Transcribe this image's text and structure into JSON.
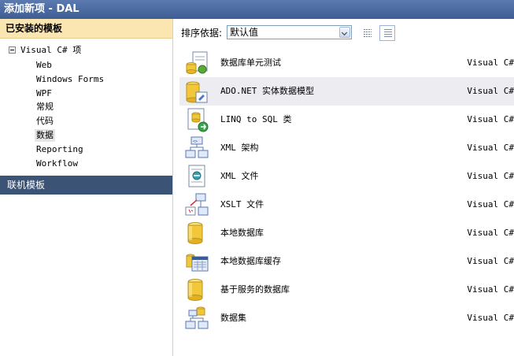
{
  "window": {
    "title": "添加新项 - DAL"
  },
  "left_panel": {
    "installed_header": "已安装的模板",
    "tree": {
      "root": "Visual C# 项",
      "items": [
        "Web",
        "Windows Forms",
        "WPF",
        "常规",
        "代码",
        "数据",
        "Reporting",
        "Workflow"
      ],
      "selected": "数据"
    },
    "online_header": "联机模板"
  },
  "toolbar": {
    "sort_label": "排序依据:",
    "sort_value": "默认值",
    "view_buttons": [
      "list-view-icon",
      "details-view-icon"
    ]
  },
  "templates": [
    {
      "name": "数据库单元测试",
      "type": "Visual C#",
      "icon": "database-unit-test-icon"
    },
    {
      "name": "ADO.NET 实体数据模型",
      "type": "Visual C#",
      "icon": "entity-data-model-icon",
      "selected": true
    },
    {
      "name": "LINQ to SQL 类",
      "type": "Visual C#",
      "icon": "linq-to-sql-icon"
    },
    {
      "name": "XML 架构",
      "type": "Visual C#",
      "icon": "xml-schema-icon"
    },
    {
      "name": "XML 文件",
      "type": "Visual C#",
      "icon": "xml-file-icon"
    },
    {
      "name": "XSLT 文件",
      "type": "Visual C#",
      "icon": "xslt-file-icon"
    },
    {
      "name": "本地数据库",
      "type": "Visual C#",
      "icon": "local-database-icon"
    },
    {
      "name": "本地数据库缓存",
      "type": "Visual C#",
      "icon": "local-database-cache-icon"
    },
    {
      "name": "基于服务的数据库",
      "type": "Visual C#",
      "icon": "service-database-icon"
    },
    {
      "name": "数据集",
      "type": "Visual C#",
      "icon": "dataset-icon"
    }
  ],
  "colors": {
    "title_bar": "#3e5d92",
    "installed_header_bg": "#fbe5b1",
    "online_header_bg": "#3b5374",
    "selected_row_bg": "#ececf1"
  }
}
